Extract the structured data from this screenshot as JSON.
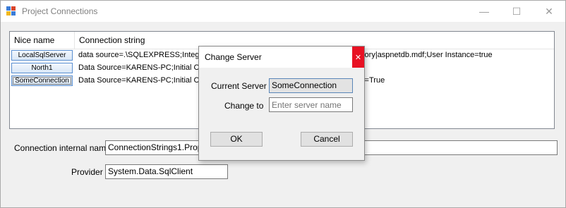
{
  "window": {
    "title": "Project Connections",
    "controls": {
      "minimize": "—",
      "maximize": "☐",
      "close": "✕"
    }
  },
  "grid": {
    "columns": [
      "Nice name",
      "Connection string"
    ],
    "rows": [
      {
        "name": "LocalSqlServer",
        "connection_before": "data source=.\\SQLEXPRESS;Integr",
        "connection_after": "ctory|aspnetdb.mdf;User Instance=true"
      },
      {
        "name": "North1",
        "connection_before": "Data Source=KARENS-PC;Initial Ca",
        "connection_after": ""
      },
      {
        "name": "SomeConnection",
        "connection_before": "Data Source=KARENS-PC;Initial Ca",
        "connection_after": "ty=True"
      }
    ]
  },
  "form": {
    "internal_name_label": "Connection internal name",
    "internal_name_value": "ConnectionStrings1.Propert",
    "provider_label": "Provider",
    "provider_value": "System.Data.SqlClient"
  },
  "dialog": {
    "title": "Change Server",
    "close_glyph": "✕",
    "current_server_label": "Current Server",
    "current_server_value": "SomeConnection",
    "change_to_label": "Change to",
    "change_to_placeholder": "Enter server name",
    "ok_label": "OK",
    "cancel_label": "Cancel"
  },
  "colors": {
    "accent": "#0078d7",
    "close_red": "#e81123",
    "icon_blue": "#3b7dd8",
    "icon_red": "#d9452b",
    "icon_yellow": "#f2b81e"
  }
}
